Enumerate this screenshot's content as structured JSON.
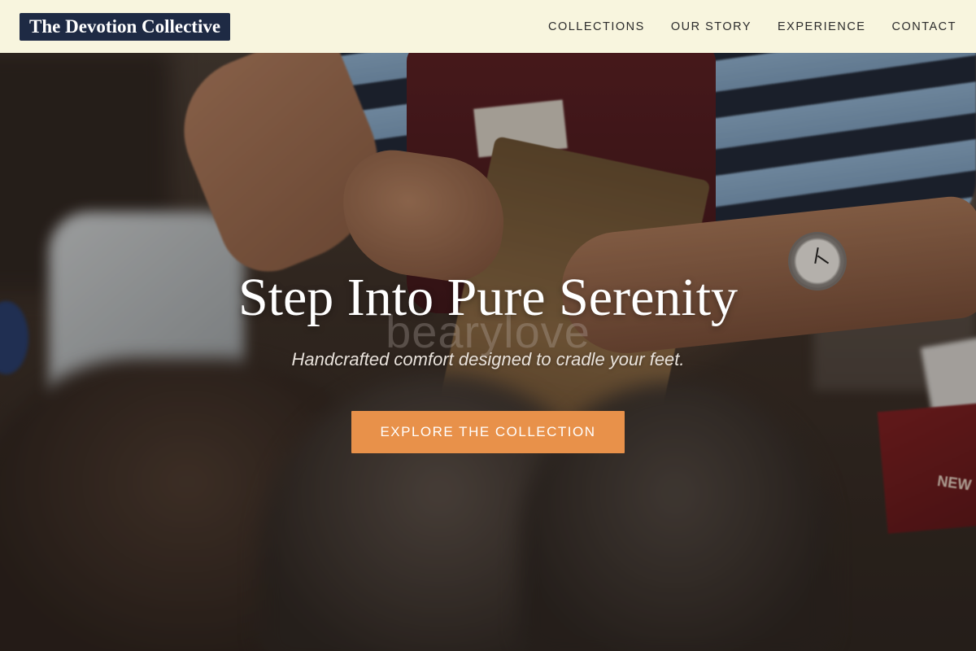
{
  "header": {
    "brand": "The Devotion Collective",
    "nav": [
      {
        "label": "COLLECTIONS"
      },
      {
        "label": "OUR STORY"
      },
      {
        "label": "EXPERIENCE"
      },
      {
        "label": "CONTACT"
      }
    ]
  },
  "hero": {
    "title": "Step Into Pure Serenity",
    "watermark": "bearylove",
    "subtitle": "Handcrafted comfort designed to cradle your feet.",
    "cta_label": "EXPLORE THE COLLECTION",
    "box_label": "NEW"
  },
  "colors": {
    "navbar_bg": "#f8f5de",
    "brand_bg": "#1e2a44",
    "cta_bg": "#e8914a",
    "hero_text": "#ffffff"
  }
}
